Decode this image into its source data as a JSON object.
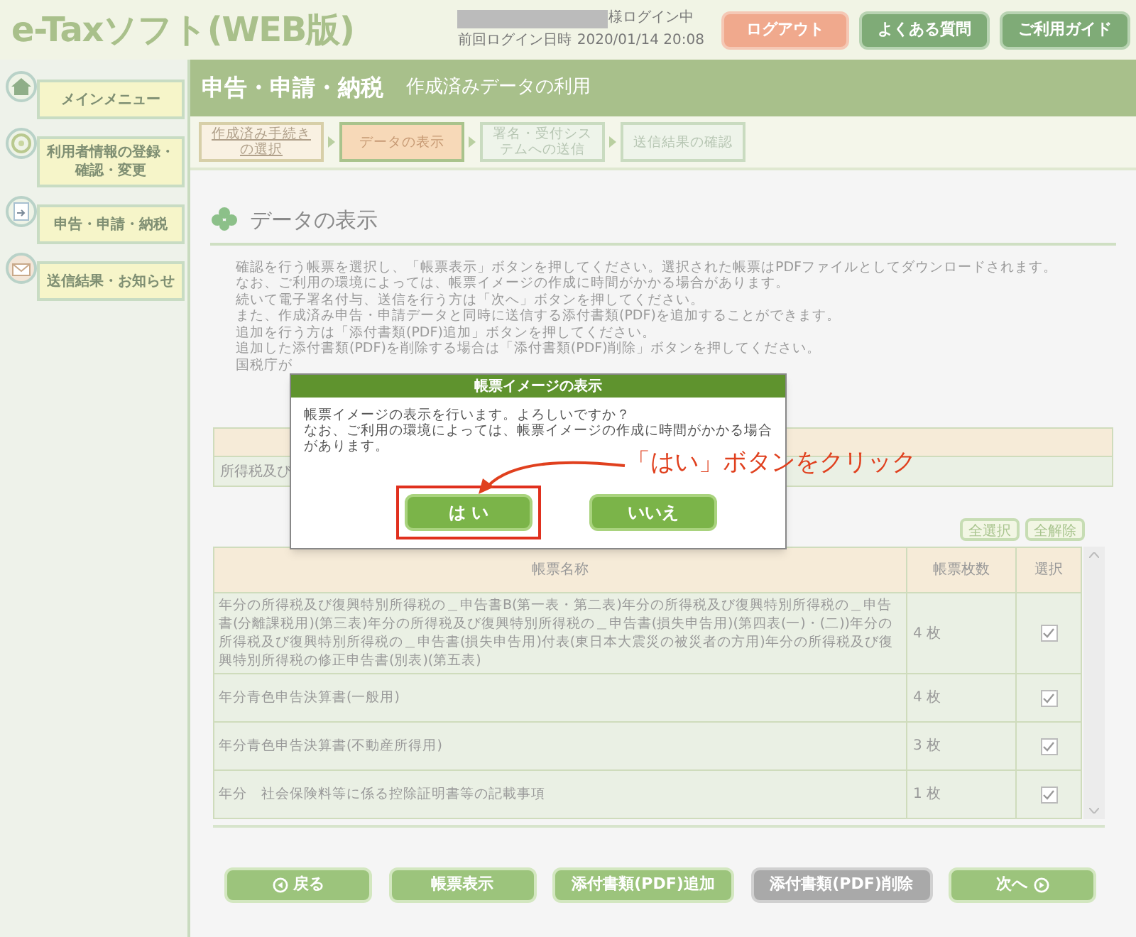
{
  "header": {
    "logo": "e-Taxソフト(WEB版)",
    "user_status": "様ログイン中",
    "last_login_label": "前回ログイン日時",
    "last_login": "2020/01/14 20:08",
    "buttons": [
      {
        "label": "ログアウト",
        "kind": "logout"
      },
      {
        "label": "よくある質問",
        "kind": "nav"
      },
      {
        "label": "ご利用ガイド",
        "kind": "nav"
      }
    ]
  },
  "sidebar": {
    "items": [
      {
        "label": "メインメニュー",
        "kind": "home"
      },
      {
        "label": "利用者情報の登録・確認・変更",
        "kind": "user"
      },
      {
        "label": "申告・申請・納税",
        "kind": "file"
      },
      {
        "label": "送信結果・お知らせ",
        "kind": "mail"
      }
    ]
  },
  "title_bar": {
    "title": "申告・申請・納税",
    "subtitle": "作成済みデータの利用"
  },
  "steps": [
    {
      "label": "作成済み手続きの選択",
      "kind": "link"
    },
    {
      "label": "データの表示",
      "kind": "current"
    },
    {
      "label": "署名・受付システムへの送信",
      "kind": "pending"
    },
    {
      "label": "送信結果の確認",
      "kind": "pending"
    }
  ],
  "section_title": "データの表示",
  "instructions": [
    "確認を行う帳票を選択し、「帳票表示」ボタンを押してください。選択された帳票はPDFファイルとしてダウンロードされます。",
    "なお、ご利用の環境によっては、帳票イメージの作成に時間がかかる場合があります。",
    "続いて電子署名付与、送信を行う方は「次へ」ボタンを押してください。",
    "また、作成済み申告・申請データと同時に送信する添付書類(PDF)を追加することができます。",
    "追加を行う方は「添付書類(PDF)追加」ボタンを押してください。",
    "追加した添付書類(PDF)を削除する場合は「添付書類(PDF)削除」ボタンを押してください。",
    "国税庁が"
  ],
  "procedure_table": {
    "row_text": "所得税及び"
  },
  "select_buttons": [
    "全選択",
    "全解除"
  ],
  "table": {
    "columns": [
      "帳票名称",
      "帳票枚数",
      "選択"
    ],
    "rows": [
      {
        "name": "年分の所得税及び復興特別所得税の＿申告書B(第一表・第二表)年分の所得税及び復興特別所得税の＿申告書(分離課税用)(第三表)年分の所得税及び復興特別所得税の＿申告書(損失申告用)(第四表(一)・(二))年分の所得税及び復興特別所得税の＿申告書(損失申告用)付表(東日本大震災の被災者の方用)年分の所得税及び復興特別所得税の修正申告書(別表)(第五表)",
        "count": "4 枚",
        "checked": true
      },
      {
        "name": "年分青色申告決算書(一般用)",
        "count": "4 枚",
        "checked": true
      },
      {
        "name": "年分青色申告決算書(不動産所得用)",
        "count": "3 枚",
        "checked": true
      },
      {
        "name": "年分　社会保険料等に係る控除証明書等の記載事項",
        "count": "1 枚",
        "checked": true
      }
    ]
  },
  "footer_buttons": [
    {
      "label": "戻る",
      "kind": "back",
      "disabled": false
    },
    {
      "label": "帳票表示",
      "kind": "plain",
      "disabled": false
    },
    {
      "label": "添付書類(PDF)追加",
      "kind": "plain",
      "disabled": false
    },
    {
      "label": "添付書類(PDF)削除",
      "kind": "plain",
      "disabled": true
    },
    {
      "label": "次へ",
      "kind": "next",
      "disabled": false
    }
  ],
  "dialog": {
    "title": "帳票イメージの表示",
    "message": [
      "帳票イメージの表示を行います。よろしいですか？",
      "なお、ご利用の環境によっては、帳票イメージの作成に時間がかかる場合があります。"
    ],
    "buttons": [
      {
        "label": "は い",
        "highlighted": true
      },
      {
        "label": "いいえ",
        "highlighted": false
      }
    ],
    "annotation": "「はい」ボタンをクリック"
  }
}
